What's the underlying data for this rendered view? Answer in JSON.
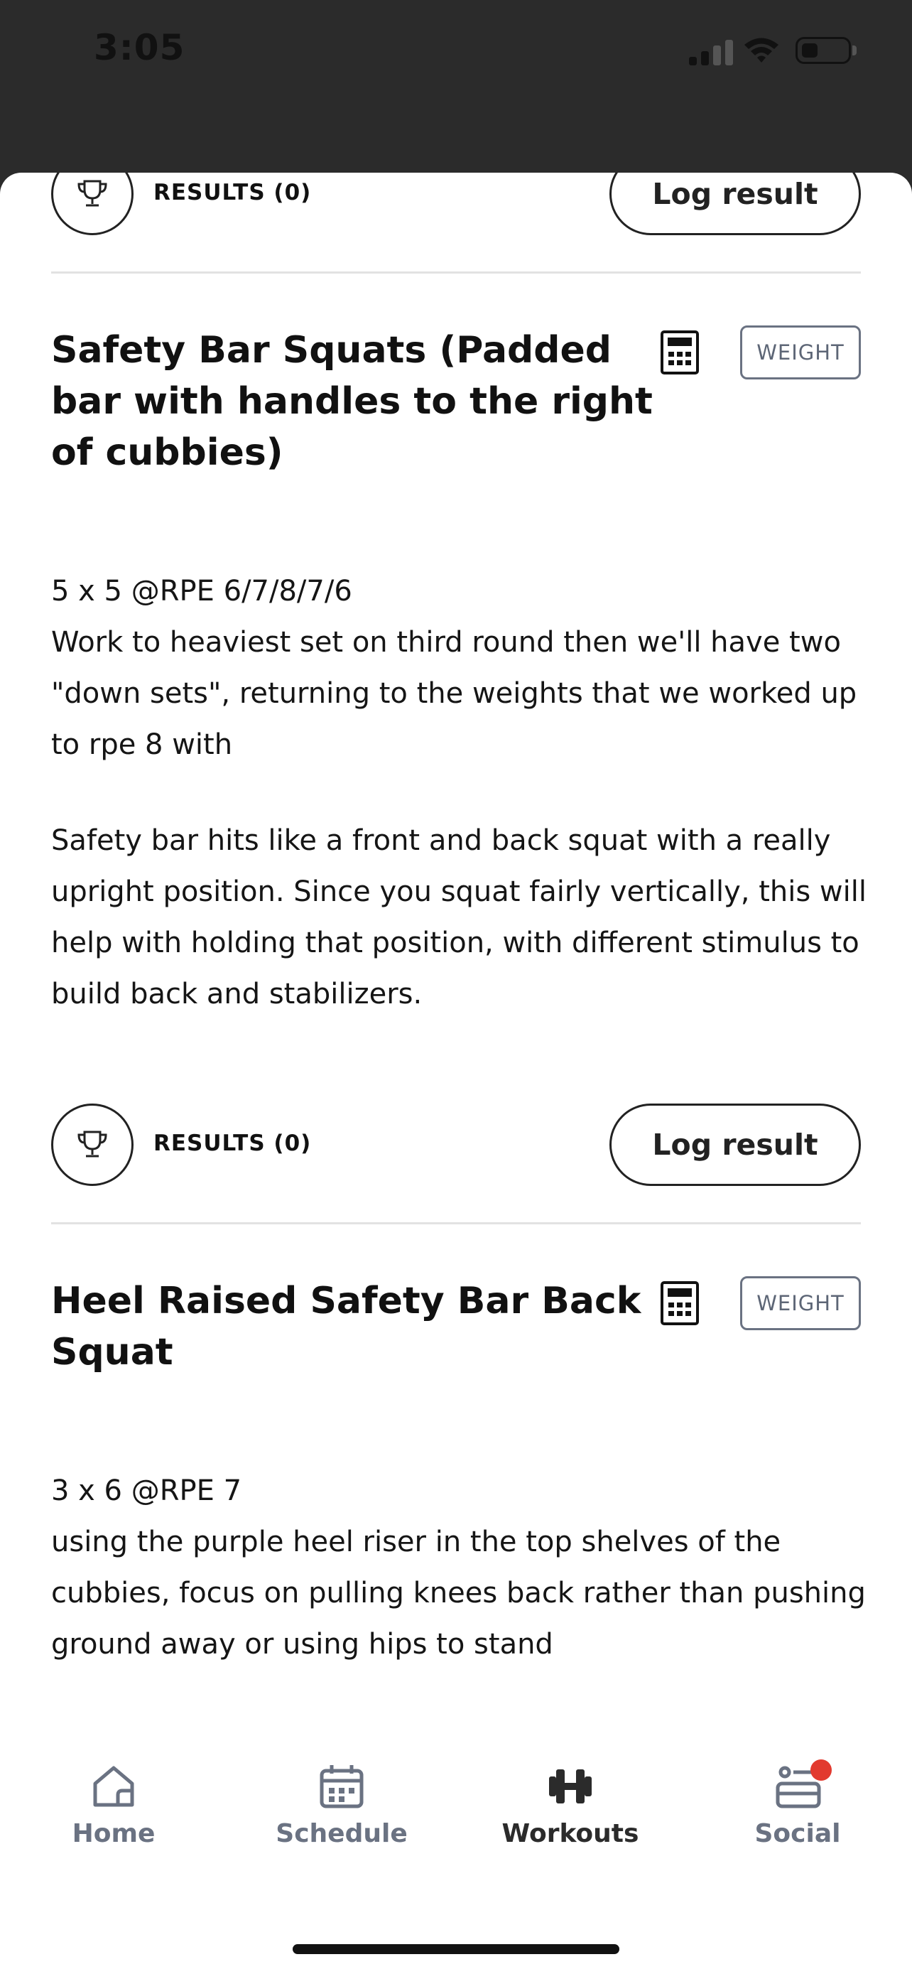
{
  "status_bar": {
    "time": "3:05"
  },
  "sections": [
    {
      "results_label": "RESULTS (0)",
      "log_label": "Log result"
    },
    {
      "title": "Safety Bar Squats (Padded bar with handles to the right of cubbies)",
      "badge": "WEIGHT",
      "scheme": "5 x 5 @RPE 6/7/8/7/6",
      "note1": "Work to heaviest set on third round then we'll have two \"down sets\", returning to the weights that we worked up to rpe 8 with",
      "note2": "Safety bar hits like a front and back squat with a really upright position. Since you squat fairly vertically, this will help with holding that position, with different stimulus to build back and stabilizers.",
      "results_label": "RESULTS (0)",
      "log_label": "Log result"
    },
    {
      "title": "Heel Raised Safety Bar Back Squat",
      "badge": "WEIGHT",
      "scheme": "3 x 6 @RPE 7",
      "note1": "using the purple heel riser in the top shelves of the cubbies, focus on pulling knees back rather than pushing ground away or using hips to stand"
    }
  ],
  "tab_bar": {
    "items": [
      {
        "label": "Home",
        "icon": "home-icon",
        "active": false
      },
      {
        "label": "Schedule",
        "icon": "calendar-icon",
        "active": false
      },
      {
        "label": "Workouts",
        "icon": "dumbbell-icon",
        "active": true
      },
      {
        "label": "Social",
        "icon": "social-feed-icon",
        "active": false,
        "notification": true
      }
    ]
  },
  "colors": {
    "status_bar_bg": "#2b2b2b",
    "notification_dot": "#e23a2f",
    "inactive_tab": "#6a7282",
    "badge_border": "#6a7282"
  }
}
